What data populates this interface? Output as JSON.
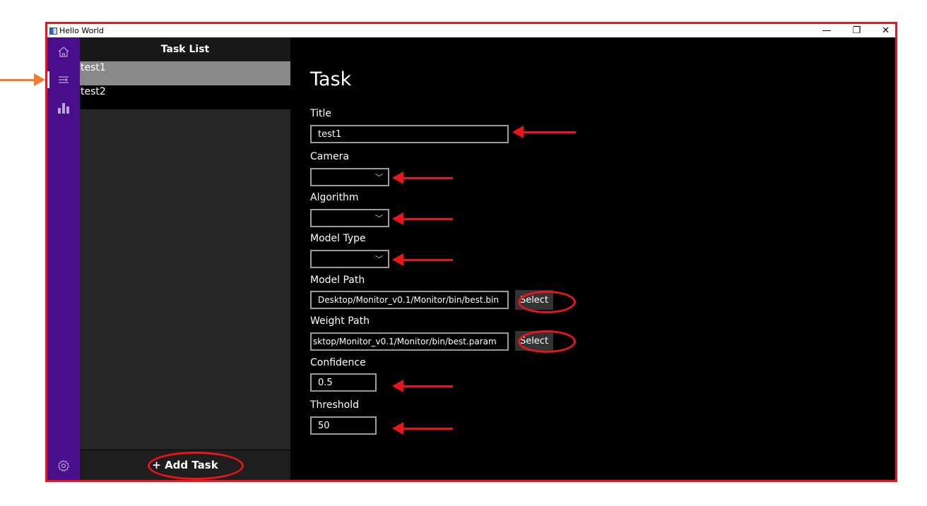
{
  "window": {
    "title": "Hello World",
    "controls": {
      "minimize": "—",
      "restore": "❐",
      "close": "✕"
    }
  },
  "nav": {
    "items": [
      {
        "icon": "home-icon",
        "glyph": "⌂"
      },
      {
        "icon": "task-list-icon",
        "glyph": "☰",
        "active": true
      },
      {
        "icon": "bar-chart-icon",
        "glyph": "▟"
      }
    ],
    "settings_glyph": "⚙"
  },
  "task_panel": {
    "header": "Task List",
    "tasks": [
      "test1",
      "test2"
    ],
    "selected_index": 0,
    "add_button": "+ Add Task"
  },
  "form": {
    "page_title": "Task",
    "title_label": "Title",
    "title_value": "test1",
    "camera_label": "Camera",
    "algorithm_label": "Algorithm",
    "model_type_label": "Model Type",
    "model_path_label": "Model Path",
    "model_path_value": "Desktop/Monitor_v0.1/Monitor/bin/best.bin",
    "weight_path_label": "Weight Path",
    "weight_path_value": "sktop/Monitor_v0.1/Monitor/bin/best.param",
    "select_label": "Select",
    "confidence_label": "Confidence",
    "confidence_value": "0.5",
    "threshold_label": "Threshold",
    "threshold_value": "50",
    "chevron": "﹀"
  },
  "colors": {
    "nav_rail": "#4a0d8b",
    "annotation_red": "#e8151b",
    "annotation_orange": "#ee7d2f",
    "selected_task": "#898989"
  }
}
